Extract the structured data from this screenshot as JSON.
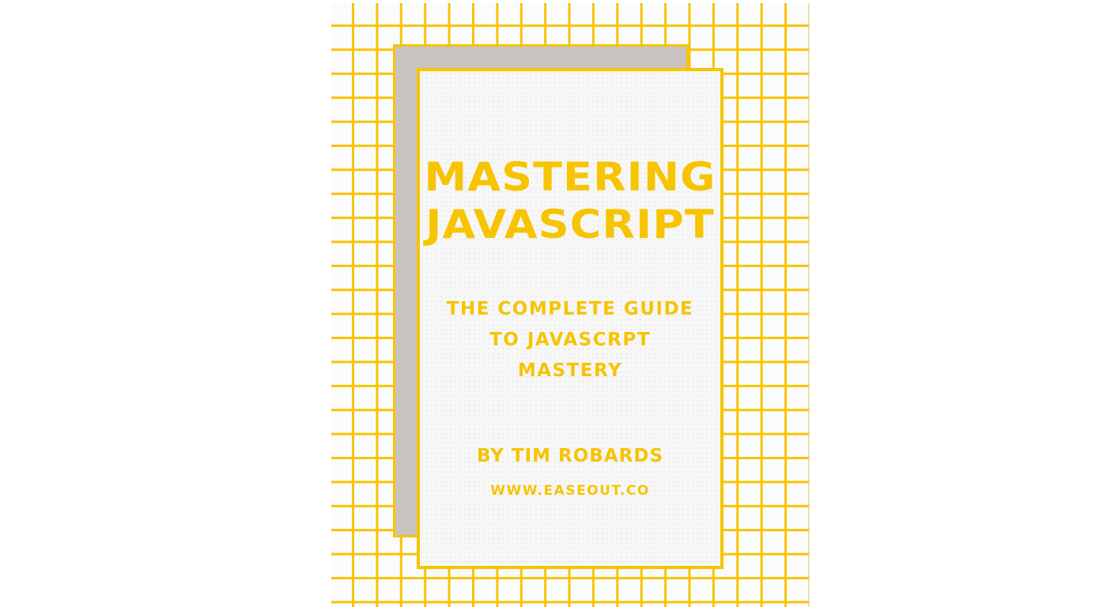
{
  "cover": {
    "title_line1": "MASTERING",
    "title_line2": "JAVASCRIPT",
    "subtitle_line1": "THE COMPLETE GUIDE",
    "subtitle_line2": "TO JAVASCRPT",
    "subtitle_line3": "MASTERY",
    "author": "BY TIM ROBARDS",
    "website": "WWW.EASEOUT.CO"
  },
  "colors": {
    "accent": "#f6c400",
    "back_sheet": "#c8c3bf",
    "paper": "#f7f7f7",
    "grid_background": "#fbfbfb"
  }
}
